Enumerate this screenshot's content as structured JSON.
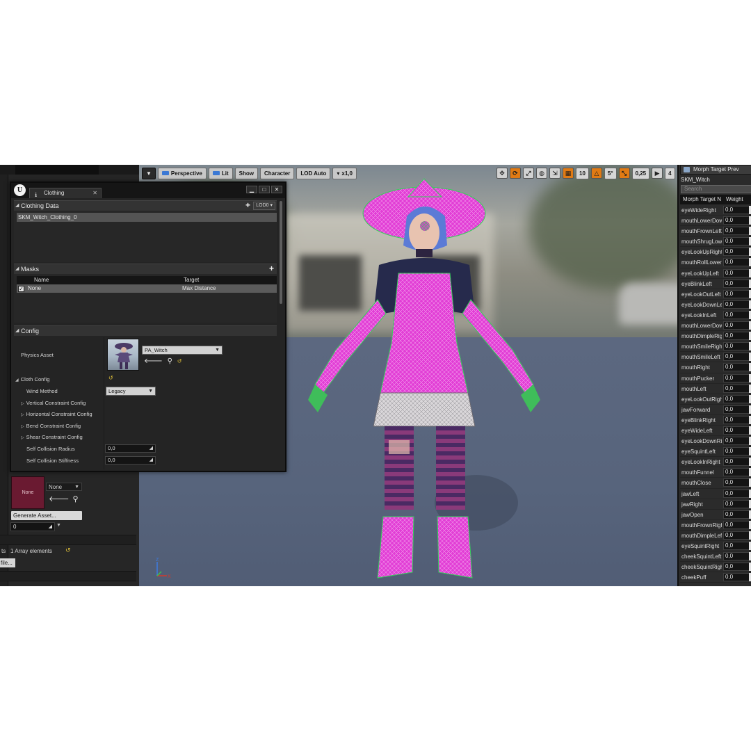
{
  "viewport": {
    "toolbar": {
      "perspective": "Perspective",
      "lit": "Lit",
      "show": "Show",
      "character": "Character",
      "lod": "LOD Auto",
      "speed": "x1,0",
      "grid_size": "10",
      "rotation_snap": "5°",
      "scale_snap": "0,25",
      "camera_speed": "4"
    },
    "axis": {
      "z": "Z",
      "x": "X"
    }
  },
  "clothing_window": {
    "tab_title": "Clothing",
    "clothing_data": {
      "header": "Clothing Data",
      "lod": "LOD0",
      "items": [
        "SKM_Witch_Clothing_0"
      ]
    },
    "masks": {
      "header": "Masks",
      "columns": [
        "Name",
        "Target"
      ],
      "rows": [
        {
          "checked": true,
          "name": "None",
          "target": "Max Distance"
        }
      ]
    },
    "config": {
      "header": "Config",
      "physics_asset_label": "Physics Asset",
      "physics_asset_value": "PA_Witch",
      "cloth_config_label": "Cloth Config",
      "wind_method_label": "Wind Method",
      "wind_method_value": "Legacy",
      "vertical_constraint": "Vertical Constraint Config",
      "horizontal_constraint": "Horizontal Constraint Config",
      "bend_constraint": "Bend Constraint Config",
      "shear_constraint": "Shear Constraint Config",
      "self_collision_radius_label": "Self Collision Radius",
      "self_collision_radius_value": "0,0",
      "self_collision_stiffness_label": "Self Collision Stiffness",
      "self_collision_stiffness_value": "0,0"
    }
  },
  "left_panel": {
    "thumb_label": "None",
    "combo_value": "None",
    "generate_button": "Generate Asset...",
    "number_value": "0",
    "array_prefix": "ts",
    "array_label": "1 Array elements",
    "file_button": "file..."
  },
  "morph_panel": {
    "tab_title": "Morph Target Prev",
    "asset": "SKM_Witch",
    "search_placeholder": "Search",
    "columns": [
      "Morph Target N",
      "Weight"
    ],
    "rows": [
      {
        "name": "eyeWideRight",
        "weight": "0,0"
      },
      {
        "name": "mouthLowerDownLeft",
        "weight": "0,0"
      },
      {
        "name": "mouthFrownLeft",
        "weight": "0,0"
      },
      {
        "name": "mouthShrugLower",
        "weight": "0,0"
      },
      {
        "name": "eyeLookUpRight",
        "weight": "0,0"
      },
      {
        "name": "mouthRollLower",
        "weight": "0,0"
      },
      {
        "name": "eyeLookUpLeft",
        "weight": "0,0"
      },
      {
        "name": "eyeBlinkLeft",
        "weight": "0,0"
      },
      {
        "name": "eyeLookOutLeft",
        "weight": "0,0"
      },
      {
        "name": "eyeLookDownLeft",
        "weight": "0,0"
      },
      {
        "name": "eyeLookInLeft",
        "weight": "0,0"
      },
      {
        "name": "mouthLowerDownRight",
        "weight": "0,0"
      },
      {
        "name": "mouthDimpleRight",
        "weight": "0,0"
      },
      {
        "name": "mouthSmileRight",
        "weight": "0,0"
      },
      {
        "name": "mouthSmileLeft",
        "weight": "0,0"
      },
      {
        "name": "mouthRight",
        "weight": "0,0"
      },
      {
        "name": "mouthPucker",
        "weight": "0,0"
      },
      {
        "name": "mouthLeft",
        "weight": "0,0"
      },
      {
        "name": "eyeLookOutRight",
        "weight": "0,0"
      },
      {
        "name": "jawForward",
        "weight": "0,0"
      },
      {
        "name": "eyeBlinkRight",
        "weight": "0,0"
      },
      {
        "name": "eyeWideLeft",
        "weight": "0,0"
      },
      {
        "name": "eyeLookDownRight",
        "weight": "0,0"
      },
      {
        "name": "eyeSquintLeft",
        "weight": "0,0"
      },
      {
        "name": "eyeLookInRight",
        "weight": "0,0"
      },
      {
        "name": "mouthFunnel",
        "weight": "0,0"
      },
      {
        "name": "mouthClose",
        "weight": "0,0"
      },
      {
        "name": "jawLeft",
        "weight": "0,0"
      },
      {
        "name": "jawRight",
        "weight": "0,0"
      },
      {
        "name": "jawOpen",
        "weight": "0,0"
      },
      {
        "name": "mouthFrownRight",
        "weight": "0,0"
      },
      {
        "name": "mouthDimpleLeft",
        "weight": "0,0"
      },
      {
        "name": "eyeSquintRight",
        "weight": "0,0"
      },
      {
        "name": "cheekSquintLeft",
        "weight": "0,0"
      },
      {
        "name": "cheekSquintRight",
        "weight": "0,0"
      },
      {
        "name": "cheekPuff",
        "weight": "0,0"
      }
    ]
  },
  "colors": {
    "wireframe_pink": "#e23fd6",
    "wireframe_green": "#35d25a",
    "accent_orange": "#e07a14",
    "reset_yellow": "#e2c23a"
  }
}
